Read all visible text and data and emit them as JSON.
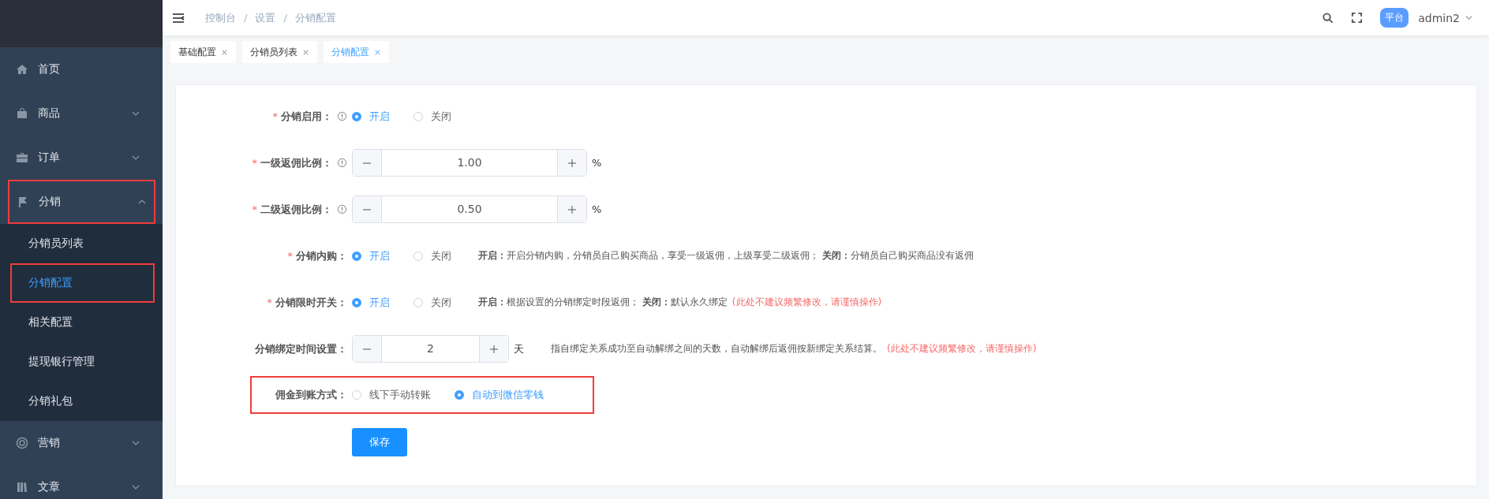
{
  "sidebar": {
    "items": [
      {
        "label": "首页",
        "highlighted": false
      },
      {
        "label": "商品",
        "expandable": true,
        "expanded": false,
        "highlighted": false
      },
      {
        "label": "订单",
        "expandable": true,
        "expanded": false,
        "highlighted": false
      },
      {
        "label": "分销",
        "expandable": true,
        "expanded": true,
        "highlighted": true,
        "children": [
          {
            "label": "分销员列表",
            "selected": false,
            "highlighted": false
          },
          {
            "label": "分销配置",
            "selected": true,
            "highlighted": true
          },
          {
            "label": "相关配置",
            "selected": false,
            "highlighted": false
          },
          {
            "label": "提现银行管理",
            "selected": false,
            "highlighted": false
          },
          {
            "label": "分销礼包",
            "selected": false,
            "highlighted": false
          }
        ]
      },
      {
        "label": "营销",
        "expandable": true,
        "expanded": false,
        "highlighted": false
      },
      {
        "label": "文章",
        "expandable": true,
        "expanded": false,
        "highlighted": false
      }
    ]
  },
  "breadcrumb": [
    {
      "kind": "link",
      "text": "控制台"
    },
    {
      "kind": "separator",
      "text": "/"
    },
    {
      "kind": "link",
      "text": "设置"
    },
    {
      "kind": "separator",
      "text": "/"
    },
    {
      "kind": "link",
      "text": "分销配置"
    }
  ],
  "header": {
    "badge": "平台",
    "user": "admin2"
  },
  "tabs": [
    {
      "label": "基础配置",
      "selected": false
    },
    {
      "label": "分销员列表",
      "selected": false
    },
    {
      "label": "分销配置",
      "selected": true
    }
  ],
  "fields": [
    {
      "kind": "radio",
      "label": "分销启用：",
      "required": "*",
      "info": true,
      "highlighted": false,
      "options": [
        {
          "label": "开启",
          "selected": true
        },
        {
          "label": "关闭",
          "selected": false
        }
      ]
    },
    {
      "kind": "number",
      "label": "一级返佣比例：",
      "required": "*",
      "info": true,
      "highlighted": false,
      "value": "1.00",
      "unit": "%"
    },
    {
      "kind": "number",
      "label": "二级返佣比例：",
      "required": "*",
      "info": true,
      "highlighted": false,
      "value": "0.50",
      "unit": "%"
    },
    {
      "kind": "radio",
      "label": "分销内购：",
      "required": "*",
      "info": false,
      "highlighted": false,
      "options": [
        {
          "label": "开启",
          "selected": true
        },
        {
          "label": "关闭",
          "selected": false
        }
      ],
      "note": "**开启：**开启分销内购，分销员自己购买商品，享受一级返佣，上级享受二级返佣； **关闭：**分销员自己购买商品没有返佣"
    },
    {
      "kind": "radio",
      "label": "分销限时开关：",
      "required": "*",
      "info": false,
      "highlighted": false,
      "options": [
        {
          "label": "开启",
          "selected": true
        },
        {
          "label": "关闭",
          "selected": false
        }
      ],
      "note": "**开启：**根据设置的分销绑定时段返佣； **关闭：**默认永久绑定",
      "warning": "(此处不建议频繁修改，请谨慎操作)"
    },
    {
      "kind": "number",
      "label": "分销绑定时间设置：",
      "info": false,
      "highlighted": false,
      "value": "2",
      "unit": "天",
      "note": "指自绑定关系成功至自动解绑之间的天数，自动解绑后返佣按新绑定关系结算。",
      "warning": "(此处不建议频繁修改，请谨慎操作)"
    },
    {
      "kind": "radio",
      "label": "佣金到账方式：",
      "info": false,
      "highlighted": true,
      "options": [
        {
          "label": "线下手动转账",
          "selected": false
        },
        {
          "label": "自动到微信零钱",
          "selected": true
        }
      ]
    }
  ],
  "save": "保存"
}
